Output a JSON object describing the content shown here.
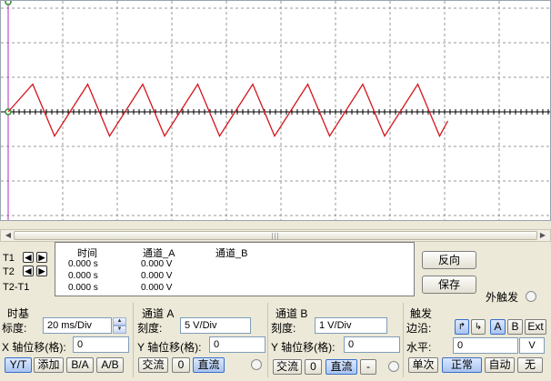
{
  "readout": {
    "headers": {
      "time": "时间",
      "channel_a": "通道_A",
      "channel_b": "通道_B"
    },
    "row_labels": [
      "T1",
      "T2",
      "T2-T1"
    ],
    "rows": [
      {
        "time": "0.000 s",
        "channel_a": "0.000 V",
        "channel_b": ""
      },
      {
        "time": "0.000 s",
        "channel_a": "0.000 V",
        "channel_b": ""
      },
      {
        "time": "0.000 s",
        "channel_a": "0.000 V",
        "channel_b": ""
      }
    ]
  },
  "buttons": {
    "reverse": "反向",
    "save": "保存"
  },
  "external_trigger": {
    "label": "外触发"
  },
  "timebase": {
    "title": "时基",
    "scale_label": "标度:",
    "scale_value": "20 ms/Div",
    "xpos_label": "X 轴位移(格):",
    "xpos_value": "0",
    "modes": [
      "Y/T",
      "添加",
      "B/A",
      "A/B"
    ],
    "active_mode": "Y/T"
  },
  "channel_a": {
    "title": "通道 A",
    "scale_label": "刻度:",
    "scale_value": "5  V/Div",
    "ypos_label": "Y 轴位移(格):",
    "ypos_value": "0",
    "coupling": [
      "交流",
      "0",
      "直流"
    ],
    "active_coupling": "直流"
  },
  "channel_b": {
    "title": "通道 B",
    "scale_label": "刻度:",
    "scale_value": "1  V/Div",
    "ypos_label": "Y 轴位移(格):",
    "ypos_value": "0",
    "coupling": [
      "交流",
      "0",
      "直流",
      "-"
    ],
    "active_coupling": "直流"
  },
  "trigger": {
    "title": "触发",
    "edge_label": "边沿:",
    "edge_buttons": [
      "A",
      "B",
      "Ext"
    ],
    "level_label": "水平:",
    "level_value": "0",
    "level_unit": "V",
    "modes": [
      "单次",
      "正常",
      "自动",
      "无"
    ],
    "active_mode": "正常"
  },
  "colors": {
    "trace": "#d4141c",
    "grid": "#9a9a9a",
    "axis": "#000000",
    "cursor": "#b030b0"
  },
  "waveform": {
    "type": "sawtooth-like",
    "baseline_div": 0,
    "peak_div": 0.8,
    "trough_div": -0.7,
    "visible_cycles": 8
  }
}
